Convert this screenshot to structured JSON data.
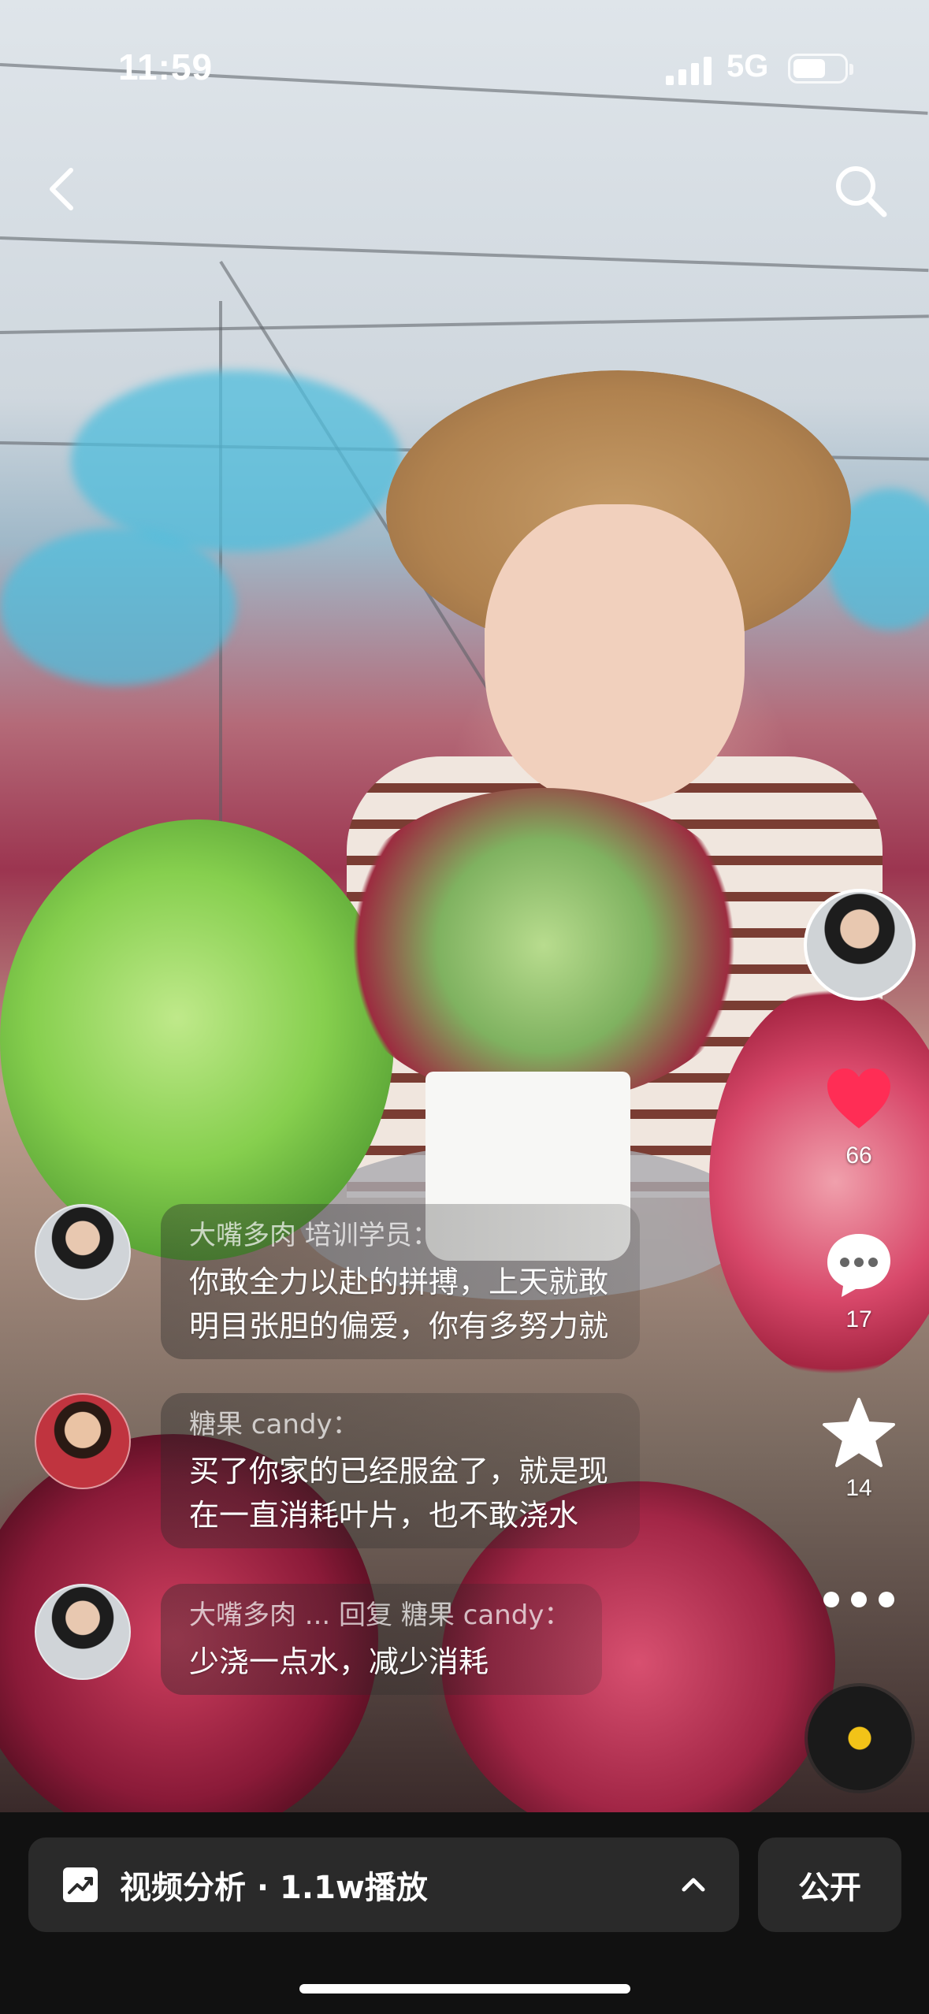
{
  "status_bar": {
    "time": "11:59",
    "network": "5G"
  },
  "icons": {
    "back": "back-chevron-icon",
    "search": "search-icon",
    "like": "heart-icon",
    "comment": "comment-bubble-icon",
    "favorite": "star-icon",
    "more": "more-dots-icon",
    "music": "music-disc-icon",
    "analysis": "trend-chart-icon",
    "expand": "chevron-up-icon"
  },
  "actions": {
    "likes": "66",
    "comments": "17",
    "favorites": "14"
  },
  "comments": [
    {
      "user": "大嘴多肉  培训学员：",
      "lines": [
        "你敢全力以赴的拼搏，上天就敢",
        "明目张胆的偏爱，你有多努力就"
      ]
    },
    {
      "user": "糖果 candy：",
      "lines": [
        "买了你家的已经服盆了，就是现",
        "在一直消耗叶片，也不敢浇水"
      ]
    },
    {
      "user": "大嘴多肉 ... 回复 糖果 candy：",
      "lines": [
        "少浇一点水，减少消耗"
      ]
    }
  ],
  "bottom_bar": {
    "analysis_label": "视频分析 · 1.1w播放",
    "public_label": "公开"
  },
  "colors": {
    "like_heart": "#ff2d55",
    "music_dot": "#f2c318",
    "bottom_bg": "#111111",
    "pill_bg": "#2a2a2a"
  }
}
